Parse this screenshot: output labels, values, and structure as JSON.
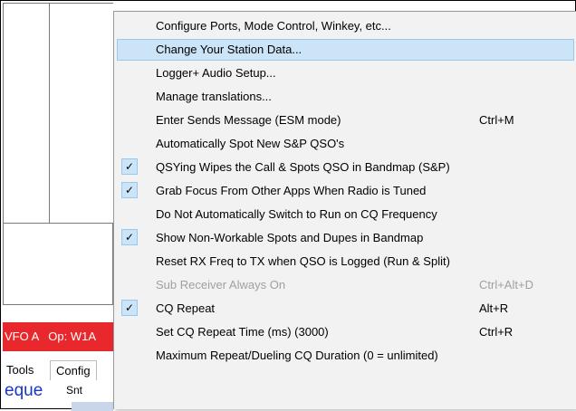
{
  "background": {
    "status_vfo": "VFO A",
    "status_op": "Op: W1A",
    "menu_tools": "Tools",
    "menu_config": "Config",
    "field_text": "eque",
    "field_snt": "Snt",
    "status_color": "#e8282c"
  },
  "menu": {
    "items": [
      {
        "label": "Configure Ports, Mode Control, Winkey, etc...",
        "shortcut": "",
        "checked": false,
        "highlighted": false,
        "disabled": false
      },
      {
        "label": "Change Your Station Data...",
        "shortcut": "",
        "checked": false,
        "highlighted": true,
        "disabled": false
      },
      {
        "label": "Logger+ Audio Setup...",
        "shortcut": "",
        "checked": false,
        "highlighted": false,
        "disabled": false
      },
      {
        "label": "Manage translations...",
        "shortcut": "",
        "checked": false,
        "highlighted": false,
        "disabled": false
      },
      {
        "label": "Enter Sends Message (ESM mode)",
        "shortcut": "Ctrl+M",
        "checked": false,
        "highlighted": false,
        "disabled": false
      },
      {
        "label": "Automatically Spot New S&P QSO's",
        "shortcut": "",
        "checked": false,
        "highlighted": false,
        "disabled": false
      },
      {
        "label": "QSYing Wipes the Call & Spots QSO in Bandmap (S&P)",
        "shortcut": "",
        "checked": true,
        "highlighted": false,
        "disabled": false
      },
      {
        "label": "Grab Focus From Other Apps When Radio is Tuned",
        "shortcut": "",
        "checked": true,
        "highlighted": false,
        "disabled": false
      },
      {
        "label": "Do Not Automatically Switch to Run on CQ Frequency",
        "shortcut": "",
        "checked": false,
        "highlighted": false,
        "disabled": false
      },
      {
        "label": "Show Non-Workable Spots and Dupes in Bandmap",
        "shortcut": "",
        "checked": true,
        "highlighted": false,
        "disabled": false
      },
      {
        "label": "Reset RX Freq to TX when QSO is Logged (Run & Split)",
        "shortcut": "",
        "checked": false,
        "highlighted": false,
        "disabled": false
      },
      {
        "label": "Sub Receiver Always On",
        "shortcut": "Ctrl+Alt+D",
        "checked": false,
        "highlighted": false,
        "disabled": true
      },
      {
        "label": "CQ Repeat",
        "shortcut": "Alt+R",
        "checked": true,
        "highlighted": false,
        "disabled": false
      },
      {
        "label": "Set CQ Repeat Time (ms) (3000)",
        "shortcut": "Ctrl+R",
        "checked": false,
        "highlighted": false,
        "disabled": false
      },
      {
        "label": "Maximum Repeat/Dueling CQ Duration (0 = unlimited)",
        "shortcut": "",
        "checked": false,
        "highlighted": false,
        "disabled": false
      }
    ],
    "check_glyph": "✓",
    "highlight_color": "#cce4f7"
  }
}
